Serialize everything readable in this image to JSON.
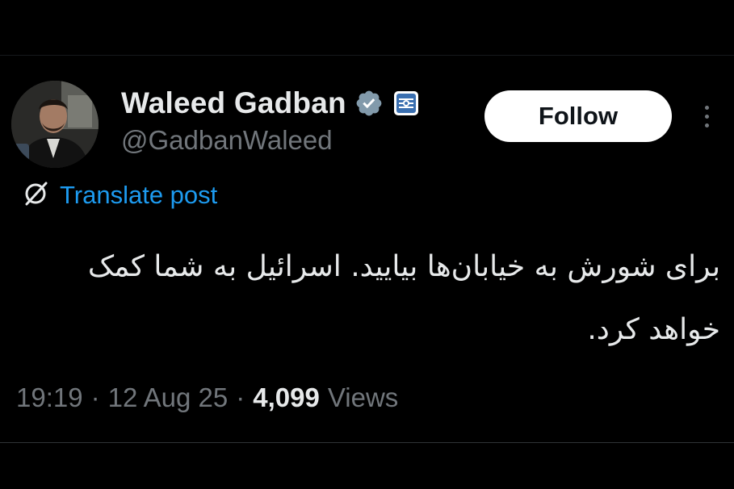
{
  "author": {
    "display_name": "Waleed Gadban",
    "handle": "@GadbanWaleed"
  },
  "actions": {
    "follow_label": "Follow"
  },
  "translate": {
    "label": "Translate post"
  },
  "post": {
    "text": "برای شورش به خیابان‌ها بیایید. اسرائیل به شما کمک خواهد کرد.",
    "direction": "rtl"
  },
  "meta": {
    "time": "19:19",
    "date": "12 Aug 25",
    "separator": "·",
    "views_count": "4,099",
    "views_label": "Views"
  },
  "icons": {
    "verified": "verified-badge-icon",
    "affiliate": "affiliate-badge-icon",
    "translate": "translate-icon",
    "more": "more-icon"
  },
  "colors": {
    "background": "#000000",
    "text_primary": "#e7e9ea",
    "text_secondary": "#71767b",
    "link_blue": "#1d9bf0",
    "verified_gray": "#829aab",
    "button_bg": "#ffffff",
    "button_text": "#0f1419",
    "divider": "#2f3336"
  }
}
